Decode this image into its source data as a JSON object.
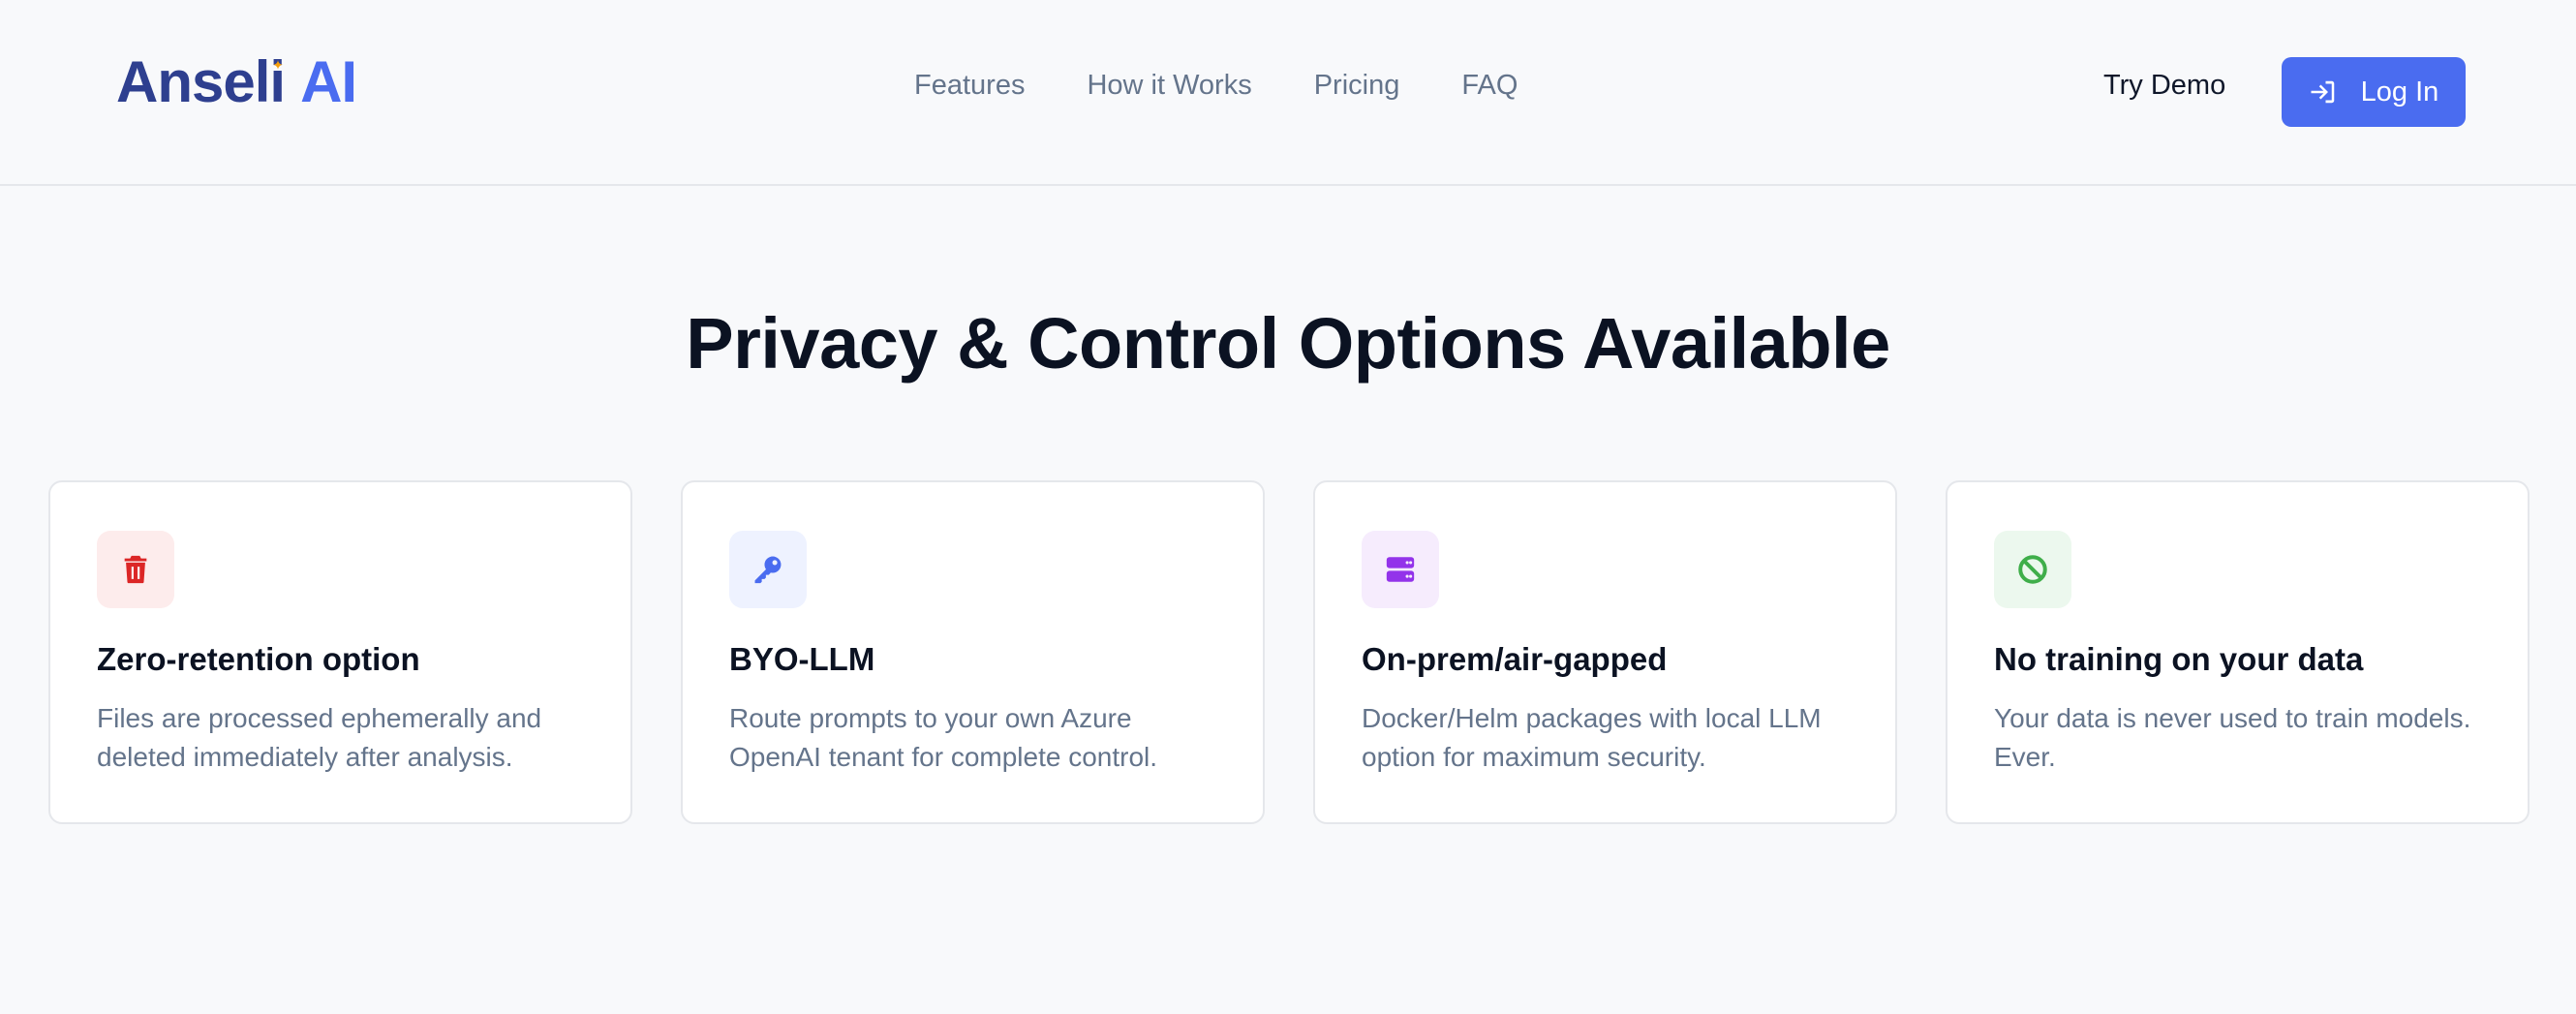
{
  "header": {
    "logo_part1": "Anseli",
    "logo_part2": "AI",
    "nav": [
      "Features",
      "How it Works",
      "Pricing",
      "FAQ"
    ],
    "try_demo": "Try Demo",
    "login": "Log In"
  },
  "section": {
    "title": "Privacy & Control Options Available"
  },
  "cards": [
    {
      "icon": "trash-icon",
      "title": "Zero-retention option",
      "desc": "Files are processed ephemerally and deleted immediately after analysis.",
      "color": "#dc2626",
      "bg": "#fdecec"
    },
    {
      "icon": "key-icon",
      "title": "BYO-LLM",
      "desc": "Route prompts to your own Azure OpenAI tenant for complete control.",
      "color": "#4a6cf0",
      "bg": "#eef2ff"
    },
    {
      "icon": "server-icon",
      "title": "On-prem/air-gapped",
      "desc": "Docker/Helm packages with local LLM option for maximum security.",
      "color": "#9333ea",
      "bg": "#f6ecfd"
    },
    {
      "icon": "ban-icon",
      "title": "No training on your data",
      "desc": "Your data is never used to train models. Ever.",
      "color": "#3fae4a",
      "bg": "#ecf8ee"
    }
  ]
}
